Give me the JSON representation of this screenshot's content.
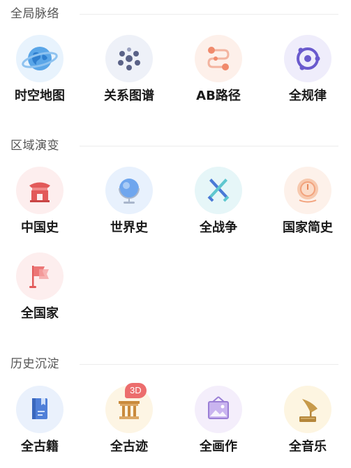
{
  "sections": [
    {
      "title": "全局脉络",
      "items": [
        {
          "label": "时空地图",
          "icon": "globe-icon"
        },
        {
          "label": "关系图谱",
          "icon": "network-graph-icon"
        },
        {
          "label": "AB路径",
          "icon": "route-path-icon"
        },
        {
          "label": "全规律",
          "icon": "orbit-pattern-icon"
        }
      ]
    },
    {
      "title": "区域演变",
      "items": [
        {
          "label": "中国史",
          "icon": "chinese-gate-icon"
        },
        {
          "label": "世界史",
          "icon": "world-globe-icon"
        },
        {
          "label": "全战争",
          "icon": "crossed-swords-icon"
        },
        {
          "label": "国家简史",
          "icon": "clock-dial-icon"
        },
        {
          "label": "全国家",
          "icon": "flag-icon"
        }
      ]
    },
    {
      "title": "历史沉淀",
      "items": [
        {
          "label": "全古籍",
          "icon": "book-icon"
        },
        {
          "label": "全古迹",
          "icon": "column-ruins-icon",
          "badge": "3D"
        },
        {
          "label": "全画作",
          "icon": "picture-frame-icon"
        },
        {
          "label": "全音乐",
          "icon": "gramophone-icon"
        }
      ]
    }
  ],
  "colors": {
    "section_title": "#555555",
    "label": "#1a1a1a",
    "badge": "#ec6d6d"
  }
}
